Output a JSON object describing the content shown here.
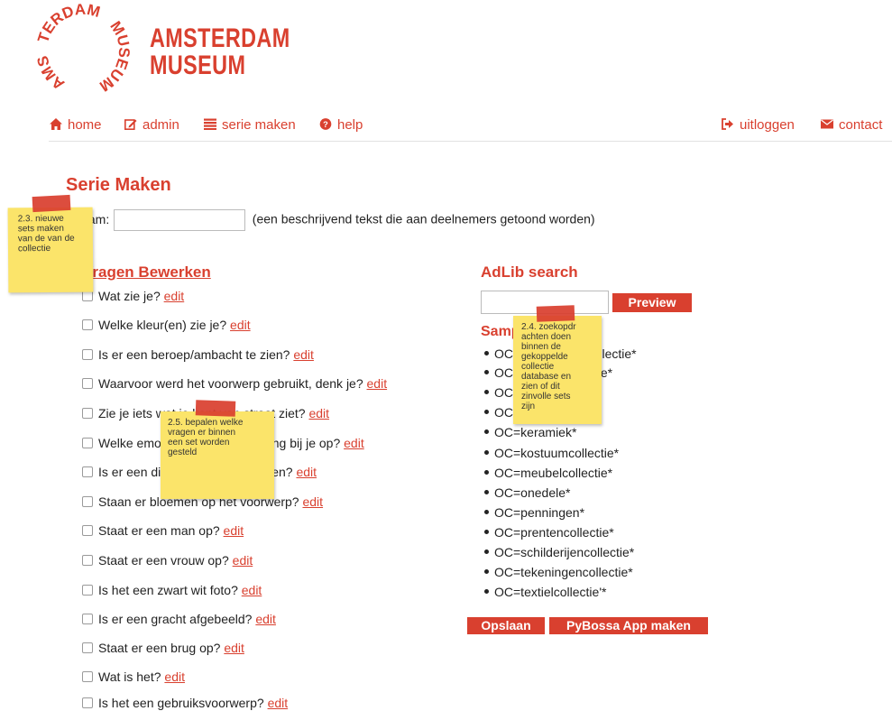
{
  "logo": {
    "line1": "AMSTERDAM",
    "line2": "MUSEUM",
    "ring_top": "MUSEUM",
    "ring_left": "AMS",
    "ring_bottom": "TERDAM"
  },
  "nav": {
    "home": "home",
    "admin": "admin",
    "serie_maken": "serie maken",
    "help": "help",
    "logout": "uitloggen",
    "contact": "contact"
  },
  "page": {
    "title": "Serie Maken",
    "name_label": "Naam:",
    "name_value": "",
    "name_hint": "(een beschrijvend tekst die aan deelnemers getoond worden)",
    "questions_title": "Vragen Bewerken"
  },
  "questions": [
    {
      "text": "Wat zie je?",
      "edit": "edit"
    },
    {
      "text": "Welke kleur(en) zie je?",
      "edit": "edit"
    },
    {
      "text": "Is er een beroep/ambacht te zien?",
      "edit": "edit"
    },
    {
      "text": "Waarvoor werd het voorwerp gebruikt, denk je?",
      "edit": "edit"
    },
    {
      "text": "Zie je iets wat je kent van straat ziet?",
      "edit": "edit"
    },
    {
      "text": "Welke emotie roept de afbeelding bij je op?",
      "edit": "edit"
    },
    {
      "text": "Is er een dier of een mens te zien?",
      "edit": "edit"
    },
    {
      "text": "Staan er bloemen op het voorwerp?",
      "edit": "edit"
    },
    {
      "text": "Staat er een man op?",
      "edit": "edit"
    },
    {
      "text": "Staat er een vrouw op?",
      "edit": "edit"
    },
    {
      "text": "Is het een zwart wit foto?",
      "edit": "edit"
    },
    {
      "text": "Is er een gracht afgebeeld?",
      "edit": "edit"
    },
    {
      "text": "Staat er een brug op?",
      "edit": "edit"
    },
    {
      "text": "Wat is het?",
      "edit": "edit"
    },
    {
      "text": "Is het een gebruiksvoorwerp?",
      "edit": "edit"
    }
  ],
  "adlib": {
    "title": "AdLib search",
    "search_value": "",
    "preview_label": "Preview",
    "sample_title": "Samples",
    "collections": [
      "OC=archeologiecollectie*",
      "OC=boekencollectie*",
      "OC=foto*",
      "OC=glas*",
      "OC=keramiek*",
      "OC=kostuumcollectie*",
      "OC=meubelcollectie*",
      "OC=onedele*",
      "OC=penningen*",
      "OC=prentencollectie*",
      "OC=schilderijencollectie*",
      "OC=tekeningencollectie*",
      "OC=textielcollectie'*"
    ],
    "save_label": "Opslaan",
    "pybossa_label": "PyBossa App maken"
  },
  "notes": {
    "note_23": "2.3. nieuwe\nsets maken\nvan de van de\ncollectie",
    "note_24": "2.4. zoekopdr\nachten doen\nbinnen de\ngekoppelde\ncollectie\ndatabase en\nzien of dit\nzinvolle sets\nzijn",
    "note_25": "2.5. bepalen welke\nvragen er binnen\neen set worden\ngesteld"
  },
  "colors": {
    "accent": "#d9402f",
    "sticky": "#fbe46a"
  }
}
